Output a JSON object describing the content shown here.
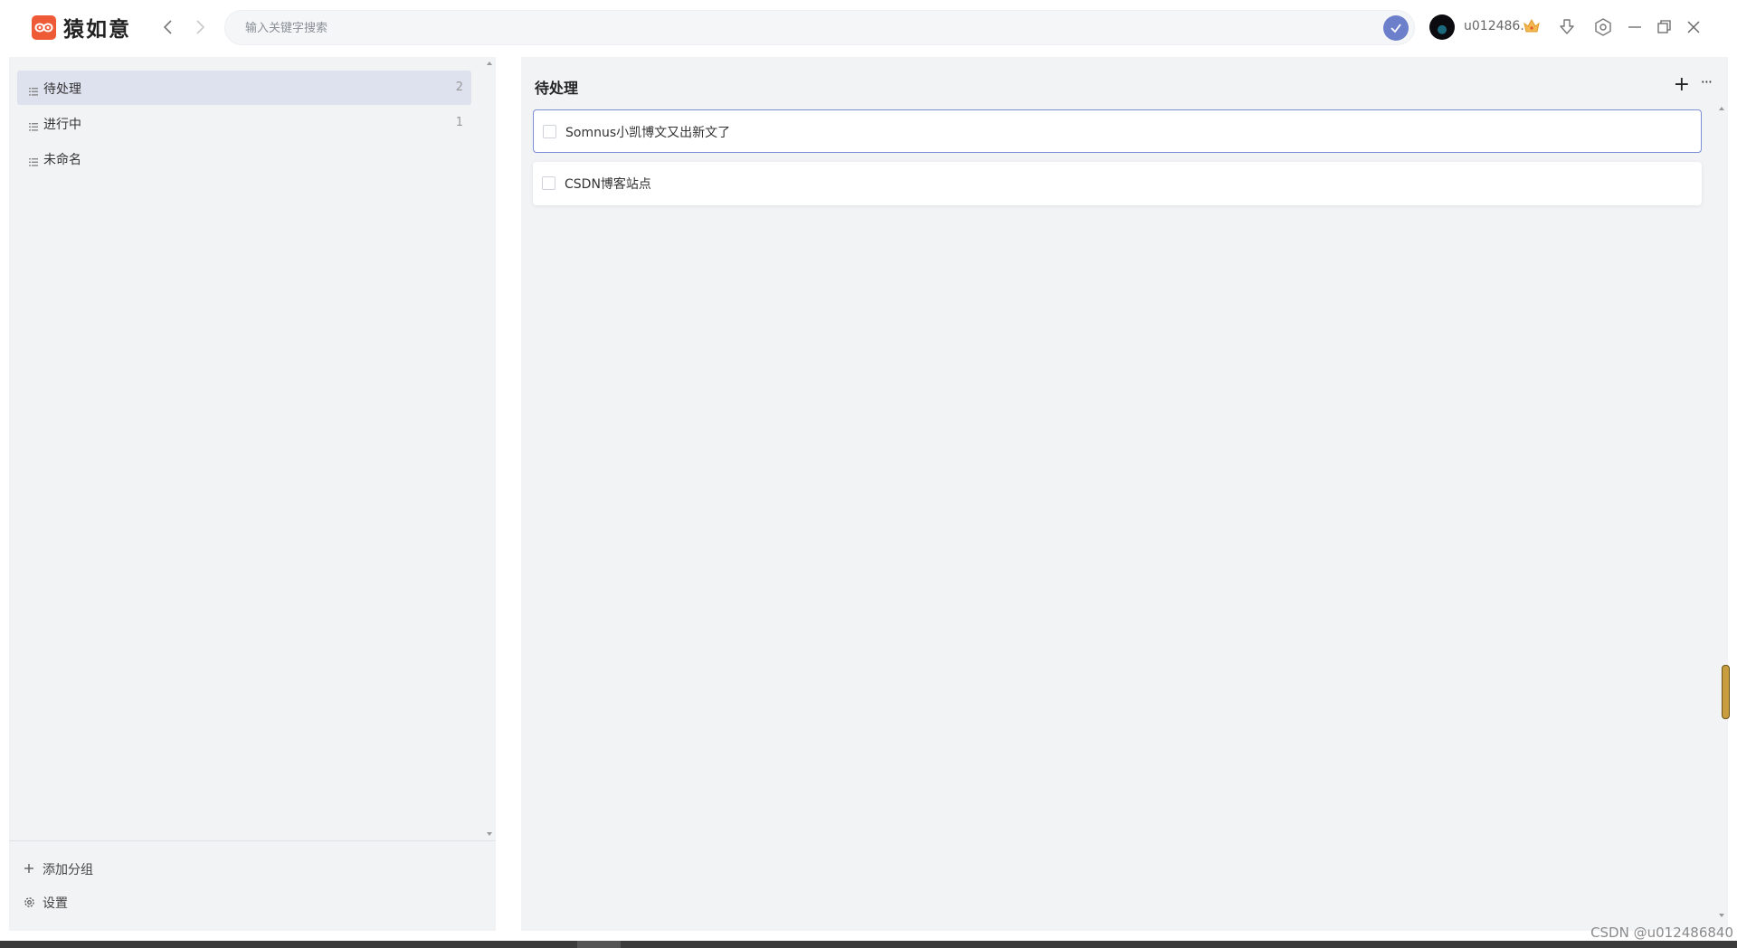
{
  "app": {
    "name": "猿如意",
    "brand_color": "#ef5a36"
  },
  "search": {
    "placeholder": "输入关键字搜索",
    "accent": "#6b7fcb"
  },
  "user": {
    "name": "u012486...",
    "badge_icon": "crown-icon"
  },
  "toolbar_icons": [
    "back-arrow-icon",
    "forward-arrow-icon",
    "download-icon",
    "settings-icon",
    "minimize-icon",
    "restore-icon",
    "close-icon"
  ],
  "sidebar": {
    "groups": [
      {
        "label": "待处理",
        "count": "2",
        "active": true
      },
      {
        "label": "进行中",
        "count": "1",
        "active": false
      },
      {
        "label": "未命名",
        "count": "",
        "active": false
      }
    ],
    "add_group": "添加分组",
    "settings": "设置"
  },
  "main": {
    "title": "待处理",
    "add_symbol": "+",
    "more_symbol": "···",
    "tasks": [
      {
        "title": "Somnus小凯博文又出新文了",
        "done": false
      },
      {
        "title": "CSDN博客站点",
        "done": false
      }
    ]
  },
  "watermark": "CSDN @u012486840"
}
